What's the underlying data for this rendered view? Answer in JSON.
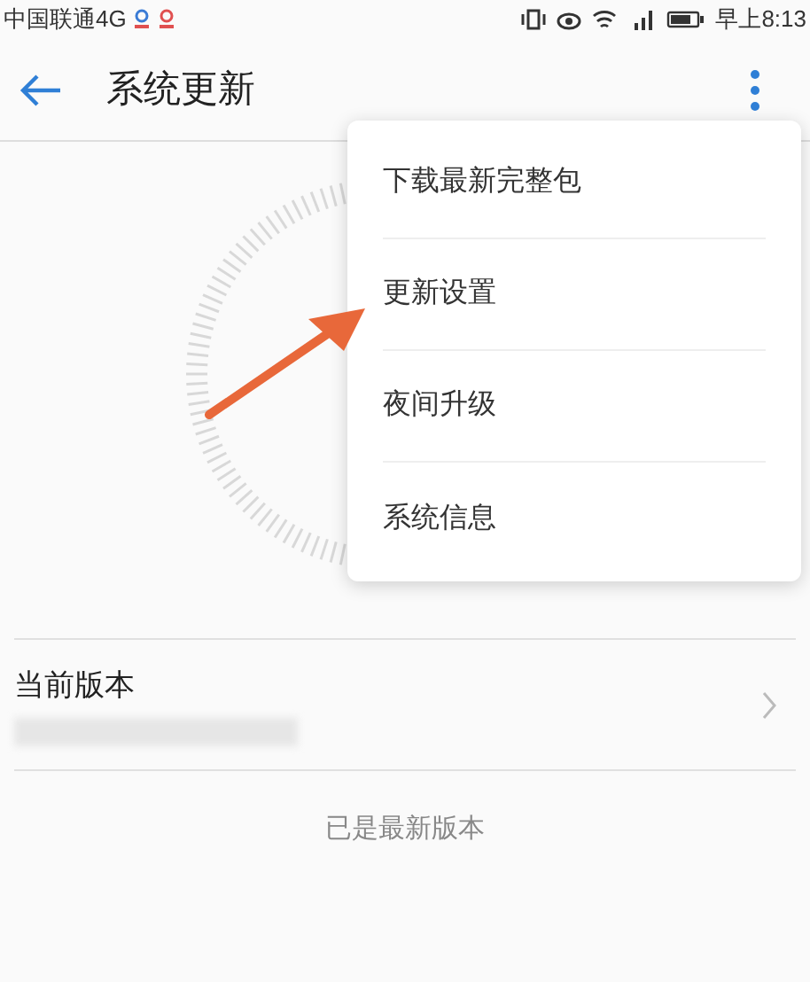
{
  "status_bar": {
    "carrier": "中国联通4G",
    "time": "早上8:13"
  },
  "app_bar": {
    "title": "系统更新"
  },
  "menu": {
    "items": [
      "下载最新完整包",
      "更新设置",
      "夜间升级",
      "系统信息"
    ]
  },
  "version_row": {
    "label": "当前版本"
  },
  "status_text": "已是最新版本"
}
